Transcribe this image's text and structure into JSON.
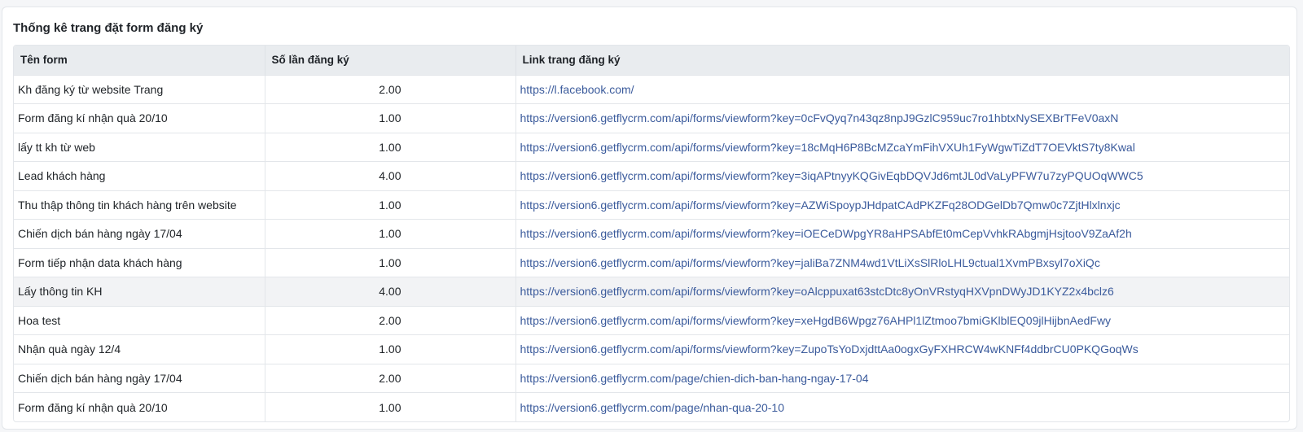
{
  "card": {
    "title": "Thống kê trang đặt form đăng ký"
  },
  "table": {
    "headers": {
      "name": "Tên form",
      "count": "Số lần đăng ký",
      "link": "Link trang đăng ký"
    },
    "rows": [
      {
        "name": "Kh đăng ký từ website Trang",
        "count": "2.00",
        "link": "https://l.facebook.com/"
      },
      {
        "name": "Form đăng kí nhận quà 20/10",
        "count": "1.00",
        "link": "https://version6.getflycrm.com/api/forms/viewform?key=0cFvQyq7n43qz8npJ9GzlC959uc7ro1hbtxNySEXBrTFeV0axN"
      },
      {
        "name": "lấy tt kh từ web",
        "count": "1.00",
        "link": "https://version6.getflycrm.com/api/forms/viewform?key=18cMqH6P8BcMZcaYmFihVXUh1FyWgwTiZdT7OEVktS7ty8Kwal"
      },
      {
        "name": "Lead khách hàng",
        "count": "4.00",
        "link": "https://version6.getflycrm.com/api/forms/viewform?key=3iqAPtnyyKQGivEqbDQVJd6mtJL0dVaLyPFW7u7zyPQUOqWWC5"
      },
      {
        "name": "Thu thập thông tin khách hàng trên website",
        "count": "1.00",
        "link": "https://version6.getflycrm.com/api/forms/viewform?key=AZWiSpoypJHdpatCAdPKZFq28ODGelDb7Qmw0c7ZjtHlxlnxjc"
      },
      {
        "name": "Chiến dịch bán hàng ngày 17/04",
        "count": "1.00",
        "link": "https://version6.getflycrm.com/api/forms/viewform?key=iOECeDWpgYR8aHPSAbfEt0mCepVvhkRAbgmjHsjtooV9ZaAf2h"
      },
      {
        "name": "Form tiếp nhận data khách hàng",
        "count": "1.00",
        "link": "https://version6.getflycrm.com/api/forms/viewform?key=jaliBa7ZNM4wd1VtLiXsSlRloLHL9ctual1XvmPBxsyl7oXiQc"
      },
      {
        "name": "Lấy thông tin KH",
        "count": "4.00",
        "link": "https://version6.getflycrm.com/api/forms/viewform?key=oAlcppuxat63stcDtc8yOnVRstyqHXVpnDWyJD1KYZ2x4bclz6"
      },
      {
        "name": "Hoa test",
        "count": "2.00",
        "link": "https://version6.getflycrm.com/api/forms/viewform?key=xeHgdB6Wpgz76AHPl1lZtmoo7bmiGKlblEQ09jlHijbnAedFwy"
      },
      {
        "name": "Nhận quà ngày 12/4",
        "count": "1.00",
        "link": "https://version6.getflycrm.com/api/forms/viewform?key=ZupoTsYoDxjdttAa0ogxGyFXHRCW4wKNFf4ddbrCU0PKQGoqWs"
      },
      {
        "name": "Chiến dịch bán hàng ngày 17/04",
        "count": "2.00",
        "link": "https://version6.getflycrm.com/page/chien-dich-ban-hang-ngay-17-04"
      },
      {
        "name": "Form đăng kí nhận quà 20/10",
        "count": "1.00",
        "link": "https://version6.getflycrm.com/page/nhan-qua-20-10"
      }
    ]
  },
  "colors": {
    "header_bg": "#e9ecef",
    "link": "#3b5b9c",
    "row_highlight": "#f2f3f5"
  }
}
